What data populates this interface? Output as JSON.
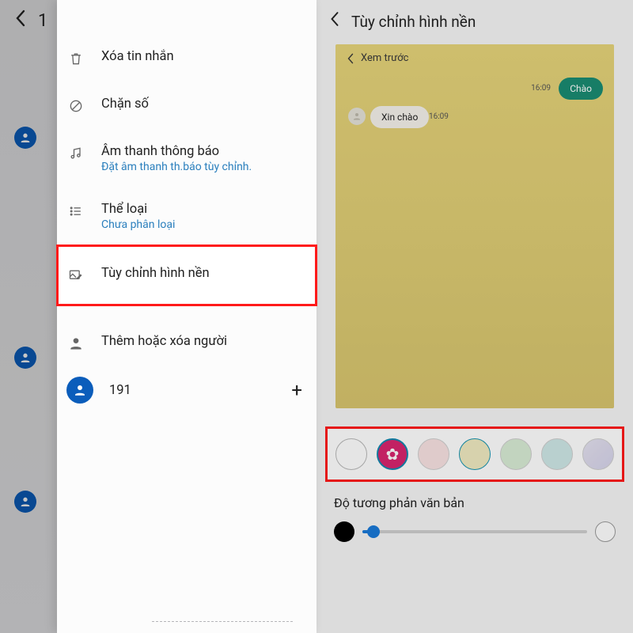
{
  "left": {
    "top_text": "1",
    "menu": {
      "delete": "Xóa tin nhắn",
      "block": "Chặn số",
      "sound": "Âm thanh thông báo",
      "sound_sub": "Đặt âm thanh th.báo tùy chỉnh.",
      "category": "Thể loại",
      "category_sub": "Chưa phân loại",
      "bg": "Tùy chỉnh hình nền",
      "people": "Thêm hoặc xóa người",
      "contact": "191",
      "plus": "+"
    }
  },
  "right": {
    "title": "Tùy chỉnh hình nền",
    "preview_label": "Xem trước",
    "out_msg": "Chào",
    "out_time": "16:09",
    "in_msg": "Xin chào",
    "in_time": "16:09",
    "contrast_label": "Độ tương phản văn bản",
    "swatches": [
      "#ffffff",
      "selected",
      "#f9e2e2",
      "#f0eac1",
      "#d9ecd5",
      "#cfe8e7",
      "#e4e2f0"
    ]
  }
}
